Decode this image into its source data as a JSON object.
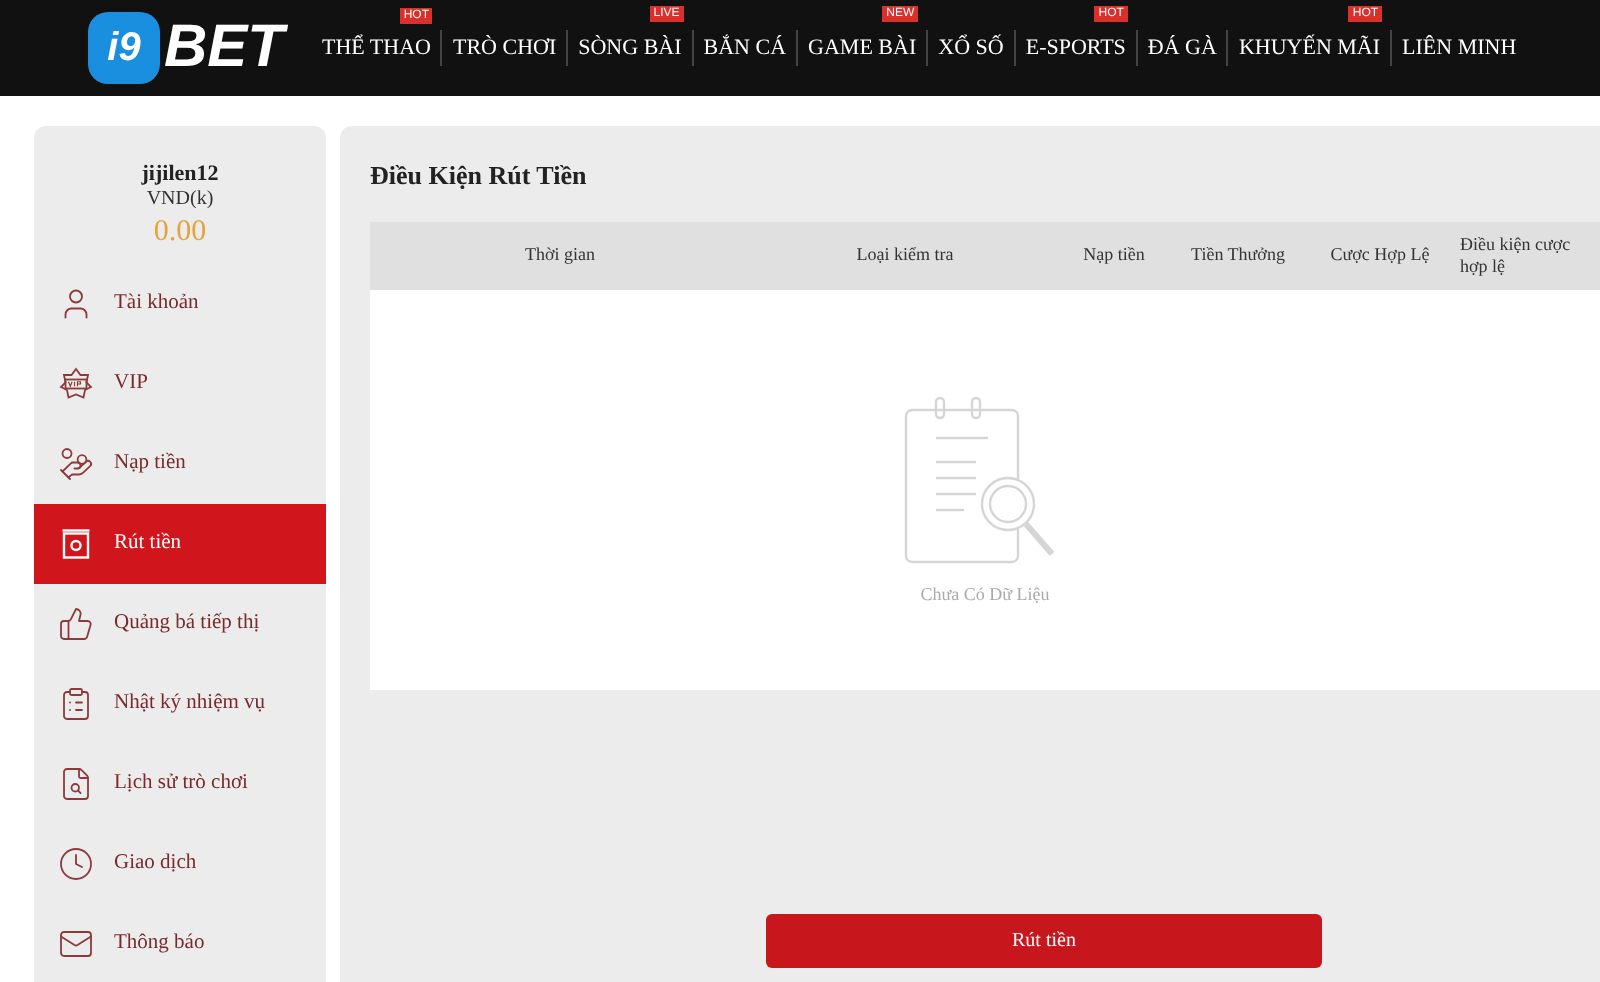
{
  "header": {
    "logo": {
      "mark": "i9",
      "text": "BET"
    },
    "nav": [
      {
        "label": "THỂ THAO",
        "badge": "HOT"
      },
      {
        "label": "TRÒ CHƠI"
      },
      {
        "label": "SÒNG BÀI",
        "badge": "LIVE"
      },
      {
        "label": "BẮN CÁ"
      },
      {
        "label": "GAME BÀI",
        "badge": "NEW"
      },
      {
        "label": "XỔ SỐ"
      },
      {
        "label": "E-SPORTS",
        "badge": "HOT"
      },
      {
        "label": "ĐÁ GÀ"
      },
      {
        "label": "KHUYẾN MÃI",
        "badge": "HOT"
      },
      {
        "label": "LIÊN MINH"
      }
    ]
  },
  "sidebar": {
    "username": "jijilen12",
    "currency": "VND(k)",
    "balance": "0.00",
    "items": [
      {
        "kind": "user",
        "label": "Tài khoản",
        "selected": false
      },
      {
        "kind": "vip",
        "label": "VIP",
        "selected": false
      },
      {
        "kind": "deposit",
        "label": "Nạp tiền",
        "selected": false
      },
      {
        "kind": "withdraw",
        "label": "Rút tiền",
        "selected": true
      },
      {
        "kind": "promo",
        "label": "Quảng bá tiếp thị",
        "selected": false
      },
      {
        "kind": "tasks",
        "label": "Nhật ký nhiệm vụ",
        "selected": false
      },
      {
        "kind": "history",
        "label": "Lịch sử trò chơi",
        "selected": false
      },
      {
        "kind": "transactions",
        "label": "Giao dịch",
        "selected": false
      },
      {
        "kind": "mail",
        "label": "Thông báo",
        "selected": false
      }
    ]
  },
  "main": {
    "title": "Điều Kiện Rút Tiền",
    "table": {
      "columns": [
        "Thời gian",
        "Loại kiểm tra",
        "Nạp tiền",
        "Tiền Thưởng",
        "Cược Hợp Lệ",
        "Điều kiện cược hợp lệ"
      ],
      "empty_text": "Chưa Có Dữ Liệu"
    },
    "submit": "Rút tiền"
  }
}
